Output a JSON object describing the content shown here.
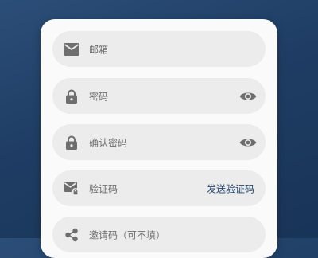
{
  "form": {
    "email": {
      "placeholder": "邮箱",
      "icon": "mail-icon"
    },
    "password": {
      "placeholder": "密码",
      "icon": "lock-icon",
      "toggle_icon": "eye-icon"
    },
    "confirm_password": {
      "placeholder": "确认密码",
      "icon": "lock-icon",
      "toggle_icon": "eye-icon"
    },
    "verification_code": {
      "placeholder": "验证码",
      "icon": "mail-lock-icon",
      "action_label": "发送验证码"
    },
    "invite_code": {
      "placeholder": "邀请码（可不填）",
      "icon": "share-icon"
    }
  },
  "colors": {
    "background": "#1f3d64",
    "card": "#fafafa",
    "field": "#ececec",
    "icon": "#6e6e6e",
    "accent": "#24466e"
  }
}
